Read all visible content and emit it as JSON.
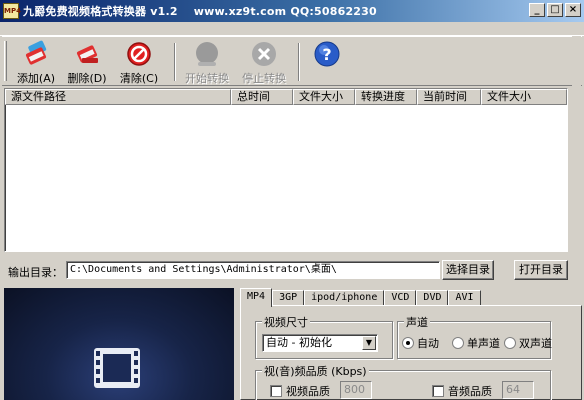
{
  "window": {
    "title": "九爵免费视频格式转换器 v1.2    www.xz9t.com QQ:50862230",
    "icon_text": "MP4",
    "controls": {
      "minimize": "_",
      "maximize": "□",
      "close": "×"
    }
  },
  "toolbar": {
    "buttons": [
      {
        "label": "添加(A)",
        "icon": "add-file-icon",
        "enabled": true
      },
      {
        "label": "删除(D)",
        "icon": "delete-file-icon",
        "enabled": true
      },
      {
        "label": "清除(C)",
        "icon": "clear-icon",
        "enabled": true
      },
      {
        "label": "开始转换",
        "icon": "start-convert-icon",
        "enabled": false
      },
      {
        "label": "停止转换",
        "icon": "stop-convert-icon",
        "enabled": false
      },
      {
        "label": "",
        "icon": "help-icon",
        "enabled": true
      }
    ]
  },
  "file_list": {
    "columns": [
      "源文件路径",
      "总时间",
      "文件大小",
      "转换进度",
      "当前时间",
      "文件大小"
    ],
    "rows": []
  },
  "output": {
    "label": "输出目录：",
    "path": "C:\\Documents and Settings\\Administrator\\桌面\\",
    "browse_label": "选择目录",
    "open_label": "打开目录"
  },
  "format_tabs": {
    "tabs": [
      "MP4",
      "3GP",
      "ipod/iphone",
      "VCD",
      "DVD",
      "AVI"
    ],
    "active": "MP4",
    "video_size": {
      "title": "视频尺寸",
      "selected": "自动 - 初始化"
    },
    "channel": {
      "title": "声道",
      "options": [
        "自动",
        "单声道",
        "双声道"
      ],
      "selected": "自动"
    },
    "quality": {
      "title": "视(音)频品质 (Kbps)",
      "video_label": "视频品质",
      "video_value": "800",
      "audio_label": "音频品质",
      "audio_value": "64"
    }
  }
}
